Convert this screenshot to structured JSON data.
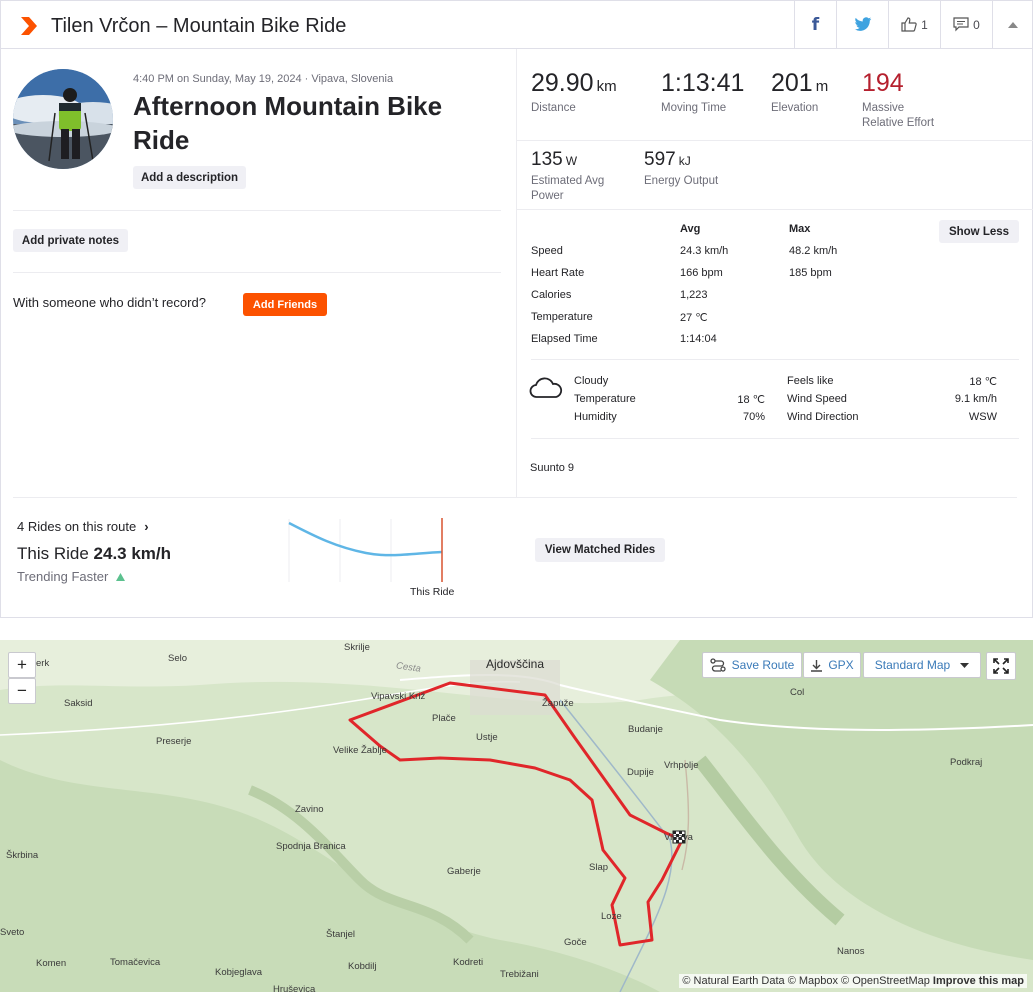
{
  "header": {
    "title": "Tilen Vrčon – Mountain Bike Ride",
    "kudos_count": "1",
    "comments_count": "0"
  },
  "activity": {
    "datetime": "4:40 PM on Sunday, May 19, 2024 · Vipava, Slovenia",
    "title": "Afternoon Mountain Bike Ride",
    "add_description": "Add a description",
    "add_private_notes": "Add private notes",
    "friends_question": "With someone who didn’t record?",
    "add_friends": "Add Friends"
  },
  "stats": {
    "distance": {
      "value": "29.90",
      "unit": "km",
      "label": "Distance"
    },
    "moving_time": {
      "value": "1:13:41",
      "label": "Moving Time"
    },
    "elevation": {
      "value": "201",
      "unit": "m",
      "label": "Elevation"
    },
    "relative_effort": {
      "value": "194",
      "label_1": "Massive",
      "label_2": "Relative Effort"
    },
    "power": {
      "value": "135",
      "unit": "W",
      "label_1": "Estimated Avg",
      "label_2": "Power"
    },
    "energy": {
      "value": "597",
      "unit": "kJ",
      "label": "Energy Output"
    }
  },
  "details": {
    "col_avg": "Avg",
    "col_max": "Max",
    "show_less": "Show Less",
    "rows": [
      {
        "label": "Speed",
        "avg": "24.3 km/h",
        "max": "48.2 km/h"
      },
      {
        "label": "Heart Rate",
        "avg": "166 bpm",
        "max": "185 bpm"
      },
      {
        "label": "Calories",
        "avg": "1,223",
        "max": ""
      },
      {
        "label": "Temperature",
        "avg": "27 ℃",
        "max": ""
      },
      {
        "label": "Elapsed Time",
        "avg": "1:14:04",
        "max": ""
      }
    ]
  },
  "weather": {
    "condition": "Cloudy",
    "temperature_label": "Temperature",
    "temperature": "18 ℃",
    "humidity_label": "Humidity",
    "humidity": "70%",
    "feels_like_label": "Feels like",
    "feels_like": "18 ℃",
    "wind_speed_label": "Wind Speed",
    "wind_speed": "9.1 km/h",
    "wind_dir_label": "Wind Direction",
    "wind_dir": "WSW"
  },
  "device": "Suunto 9",
  "segment": {
    "rides_link": "4 Rides on this route",
    "this_ride_label": "This Ride",
    "this_ride_speed": "24.3 km/h",
    "trend": "Trending Faster",
    "chart_marker_label": "This Ride",
    "view_button": "View Matched Rides"
  },
  "map": {
    "save_route": "Save Route",
    "gpx": "GPX",
    "map_style": "Standard Map",
    "zoom_in": "+",
    "zoom_out": "−",
    "attribution": "© Natural Earth Data © Mapbox © OpenStreetMap",
    "improve": "Improve this map",
    "places": [
      "Ajdovščina",
      "Selo",
      "Skrilje",
      "Saksid",
      "Vipavski Križ",
      "Plače",
      "Žapuže",
      "Budanje",
      "Preserje",
      "Velike Žablje",
      "Ustje",
      "Vrhpolje",
      "Dupije",
      "Zavino",
      "Spodnja Branica",
      "Vipava",
      "Podkraj",
      "Škrbina",
      "Gaberje",
      "Slap",
      "Col",
      "Loze",
      "Sveto",
      "Štanjel",
      "Goče",
      "Nanos",
      "Komen",
      "Tomačevica",
      "Kobjeglava",
      "Kobdilj",
      "Kodreti",
      "Trebižani",
      "Hruševica",
      "Cesta",
      "erk"
    ]
  },
  "colors": {
    "brand": "#fc5200",
    "effort": "#b5202e",
    "route": "#e0262a",
    "trend_line": "#5fb6e6"
  }
}
